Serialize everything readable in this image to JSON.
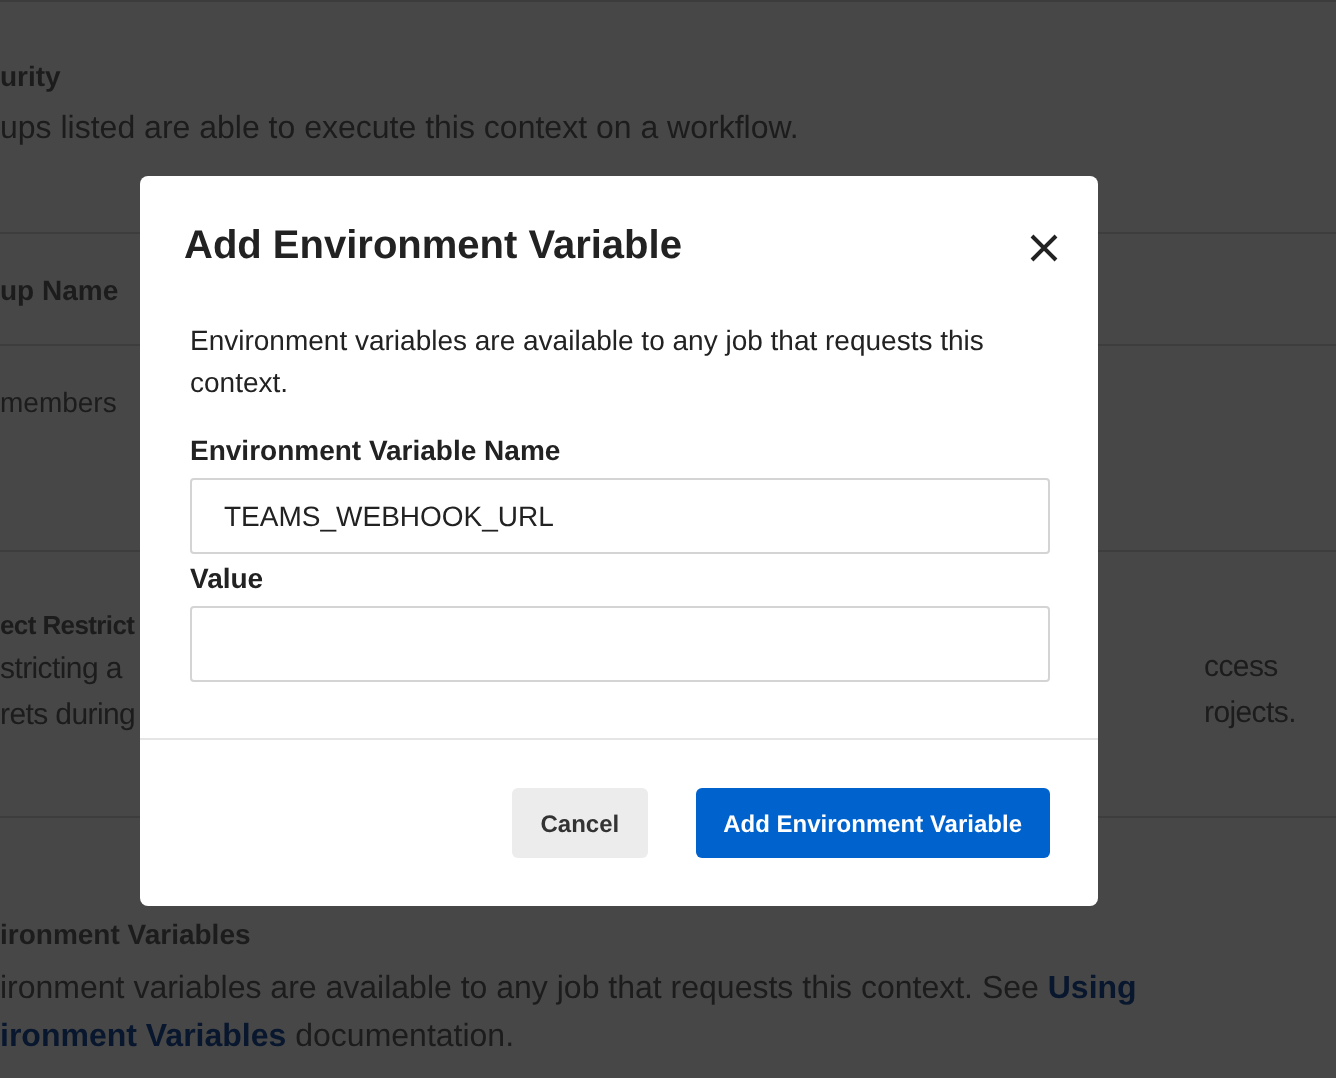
{
  "security": {
    "title": "urity",
    "text": "ups listed are able to execute this context on a workflow."
  },
  "groups_table": {
    "header": "up Name",
    "rows": [
      "members"
    ]
  },
  "project_restriction": {
    "title": "ect Restrict",
    "left_lines": [
      "stricting a",
      "rets during"
    ],
    "right_lines": [
      "ccess",
      "rojects."
    ]
  },
  "env_section": {
    "title": "ironment Variables",
    "text_before": "ironment variables are available to any job that requests this context. See ",
    "link_1": "Using",
    "link_2": "ironment Variables",
    "text_after": " documentation."
  },
  "dialog": {
    "title": "Add Environment Variable",
    "description": "Environment variables are available to any job that requests this context.",
    "fields": [
      {
        "label": "Environment Variable Name",
        "value": "TEAMS_WEBHOOK_URL"
      },
      {
        "label": "Value"
      }
    ],
    "buttons": [
      {
        "label": "Cancel",
        "kind": "secondary"
      },
      {
        "label": "Add Environment Variable",
        "kind": "primary"
      }
    ]
  }
}
